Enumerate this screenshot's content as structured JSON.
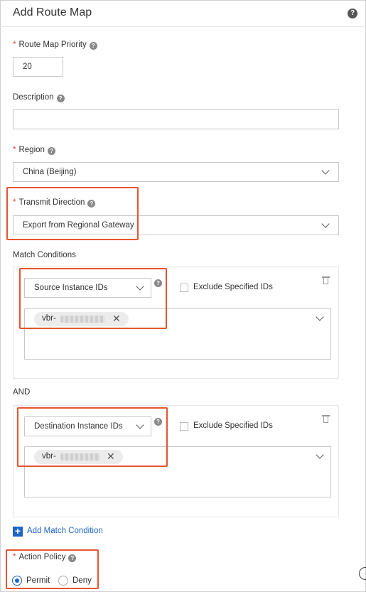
{
  "dialog": {
    "title": "Add Route Map",
    "help_icon": "question-circle-icon"
  },
  "form": {
    "priority": {
      "required_mark": "*",
      "label": "Route Map Priority",
      "value": "20"
    },
    "description": {
      "label": "Description",
      "value": ""
    },
    "region": {
      "required_mark": "*",
      "label": "Region",
      "value": "China (Beijing)"
    },
    "transmit_direction": {
      "required_mark": "*",
      "label": "Transmit Direction",
      "value": "Export from Regional Gateway"
    },
    "match_conditions": {
      "label": "Match Conditions",
      "conditions": [
        {
          "type": "Source Instance IDs",
          "exclude_label": "Exclude Specified IDs",
          "exclude_checked": false,
          "tag_prefix": "vbr-"
        },
        {
          "type": "Destination Instance IDs",
          "exclude_label": "Exclude Specified IDs",
          "exclude_checked": false,
          "tag_prefix": "vbr-"
        }
      ],
      "joiner": "AND",
      "add_label": "Add Match Condition"
    },
    "action_policy": {
      "required_mark": "*",
      "label": "Action Policy",
      "options": [
        "Permit",
        "Deny"
      ],
      "selected": "Permit"
    }
  },
  "colors": {
    "accent": "#1e64c8",
    "required": "#e4393c",
    "highlight": "#e8542e"
  }
}
